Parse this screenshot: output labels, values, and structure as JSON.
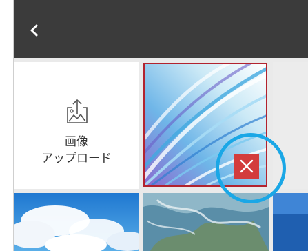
{
  "header": {
    "back_icon": "chevron-left-icon",
    "background": "#3b3b3b"
  },
  "upload": {
    "icon": "image-upload-icon",
    "label_line1": "画像",
    "label_line2": "アップロード"
  },
  "selected_image": {
    "border_color": "#b2232f",
    "delete_icon": "close-icon",
    "delete_color": "#d33c3c"
  },
  "highlight": {
    "color": "#1aa7e6"
  }
}
